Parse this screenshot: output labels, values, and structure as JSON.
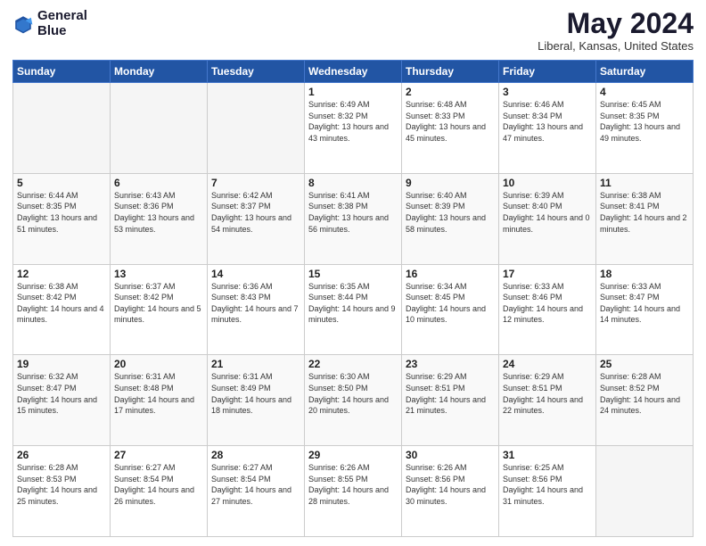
{
  "logo": {
    "line1": "General",
    "line2": "Blue"
  },
  "title": "May 2024",
  "location": "Liberal, Kansas, United States",
  "weekdays": [
    "Sunday",
    "Monday",
    "Tuesday",
    "Wednesday",
    "Thursday",
    "Friday",
    "Saturday"
  ],
  "weeks": [
    [
      {
        "day": "",
        "info": ""
      },
      {
        "day": "",
        "info": ""
      },
      {
        "day": "",
        "info": ""
      },
      {
        "day": "1",
        "info": "Sunrise: 6:49 AM\nSunset: 8:32 PM\nDaylight: 13 hours\nand 43 minutes."
      },
      {
        "day": "2",
        "info": "Sunrise: 6:48 AM\nSunset: 8:33 PM\nDaylight: 13 hours\nand 45 minutes."
      },
      {
        "day": "3",
        "info": "Sunrise: 6:46 AM\nSunset: 8:34 PM\nDaylight: 13 hours\nand 47 minutes."
      },
      {
        "day": "4",
        "info": "Sunrise: 6:45 AM\nSunset: 8:35 PM\nDaylight: 13 hours\nand 49 minutes."
      }
    ],
    [
      {
        "day": "5",
        "info": "Sunrise: 6:44 AM\nSunset: 8:35 PM\nDaylight: 13 hours\nand 51 minutes."
      },
      {
        "day": "6",
        "info": "Sunrise: 6:43 AM\nSunset: 8:36 PM\nDaylight: 13 hours\nand 53 minutes."
      },
      {
        "day": "7",
        "info": "Sunrise: 6:42 AM\nSunset: 8:37 PM\nDaylight: 13 hours\nand 54 minutes."
      },
      {
        "day": "8",
        "info": "Sunrise: 6:41 AM\nSunset: 8:38 PM\nDaylight: 13 hours\nand 56 minutes."
      },
      {
        "day": "9",
        "info": "Sunrise: 6:40 AM\nSunset: 8:39 PM\nDaylight: 13 hours\nand 58 minutes."
      },
      {
        "day": "10",
        "info": "Sunrise: 6:39 AM\nSunset: 8:40 PM\nDaylight: 14 hours\nand 0 minutes."
      },
      {
        "day": "11",
        "info": "Sunrise: 6:38 AM\nSunset: 8:41 PM\nDaylight: 14 hours\nand 2 minutes."
      }
    ],
    [
      {
        "day": "12",
        "info": "Sunrise: 6:38 AM\nSunset: 8:42 PM\nDaylight: 14 hours\nand 4 minutes."
      },
      {
        "day": "13",
        "info": "Sunrise: 6:37 AM\nSunset: 8:42 PM\nDaylight: 14 hours\nand 5 minutes."
      },
      {
        "day": "14",
        "info": "Sunrise: 6:36 AM\nSunset: 8:43 PM\nDaylight: 14 hours\nand 7 minutes."
      },
      {
        "day": "15",
        "info": "Sunrise: 6:35 AM\nSunset: 8:44 PM\nDaylight: 14 hours\nand 9 minutes."
      },
      {
        "day": "16",
        "info": "Sunrise: 6:34 AM\nSunset: 8:45 PM\nDaylight: 14 hours\nand 10 minutes."
      },
      {
        "day": "17",
        "info": "Sunrise: 6:33 AM\nSunset: 8:46 PM\nDaylight: 14 hours\nand 12 minutes."
      },
      {
        "day": "18",
        "info": "Sunrise: 6:33 AM\nSunset: 8:47 PM\nDaylight: 14 hours\nand 14 minutes."
      }
    ],
    [
      {
        "day": "19",
        "info": "Sunrise: 6:32 AM\nSunset: 8:47 PM\nDaylight: 14 hours\nand 15 minutes."
      },
      {
        "day": "20",
        "info": "Sunrise: 6:31 AM\nSunset: 8:48 PM\nDaylight: 14 hours\nand 17 minutes."
      },
      {
        "day": "21",
        "info": "Sunrise: 6:31 AM\nSunset: 8:49 PM\nDaylight: 14 hours\nand 18 minutes."
      },
      {
        "day": "22",
        "info": "Sunrise: 6:30 AM\nSunset: 8:50 PM\nDaylight: 14 hours\nand 20 minutes."
      },
      {
        "day": "23",
        "info": "Sunrise: 6:29 AM\nSunset: 8:51 PM\nDaylight: 14 hours\nand 21 minutes."
      },
      {
        "day": "24",
        "info": "Sunrise: 6:29 AM\nSunset: 8:51 PM\nDaylight: 14 hours\nand 22 minutes."
      },
      {
        "day": "25",
        "info": "Sunrise: 6:28 AM\nSunset: 8:52 PM\nDaylight: 14 hours\nand 24 minutes."
      }
    ],
    [
      {
        "day": "26",
        "info": "Sunrise: 6:28 AM\nSunset: 8:53 PM\nDaylight: 14 hours\nand 25 minutes."
      },
      {
        "day": "27",
        "info": "Sunrise: 6:27 AM\nSunset: 8:54 PM\nDaylight: 14 hours\nand 26 minutes."
      },
      {
        "day": "28",
        "info": "Sunrise: 6:27 AM\nSunset: 8:54 PM\nDaylight: 14 hours\nand 27 minutes."
      },
      {
        "day": "29",
        "info": "Sunrise: 6:26 AM\nSunset: 8:55 PM\nDaylight: 14 hours\nand 28 minutes."
      },
      {
        "day": "30",
        "info": "Sunrise: 6:26 AM\nSunset: 8:56 PM\nDaylight: 14 hours\nand 30 minutes."
      },
      {
        "day": "31",
        "info": "Sunrise: 6:25 AM\nSunset: 8:56 PM\nDaylight: 14 hours\nand 31 minutes."
      },
      {
        "day": "",
        "info": ""
      }
    ]
  ]
}
